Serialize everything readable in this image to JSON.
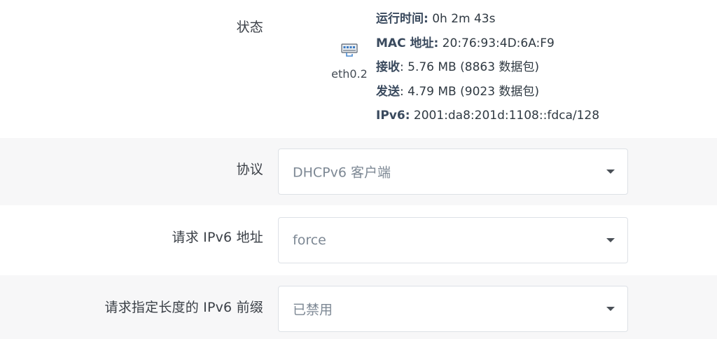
{
  "status": {
    "label": "状态",
    "interface": {
      "name": "eth0.2",
      "icon": "ethernet-port-icon"
    },
    "lines": [
      {
        "key": "运行时间:",
        "value": " 0h 2m 43s"
      },
      {
        "key": "MAC 地址:",
        "value": " 20:76:93:4D:6A:F9"
      },
      {
        "key": "接收",
        "value": ": 5.76 MB (8863 数据包)"
      },
      {
        "key": "发送",
        "value": ": 4.79 MB (9023 数据包)"
      },
      {
        "key": "IPv6:",
        "value": " 2001:da8:201d:1108::fdca/128"
      }
    ]
  },
  "protocol": {
    "label": "协议",
    "value": "DHCPv6 客户端"
  },
  "request_address": {
    "label": "请求 IPv6 地址",
    "value": "force"
  },
  "request_prefix": {
    "label": "请求指定长度的 IPv6 前缀",
    "value": "已禁用"
  },
  "colors": {
    "alt_row_bg": "#f7f7f8",
    "select_border": "#dde1e6",
    "key_text": "#3a4a5e",
    "select_text": "#7d8894"
  }
}
